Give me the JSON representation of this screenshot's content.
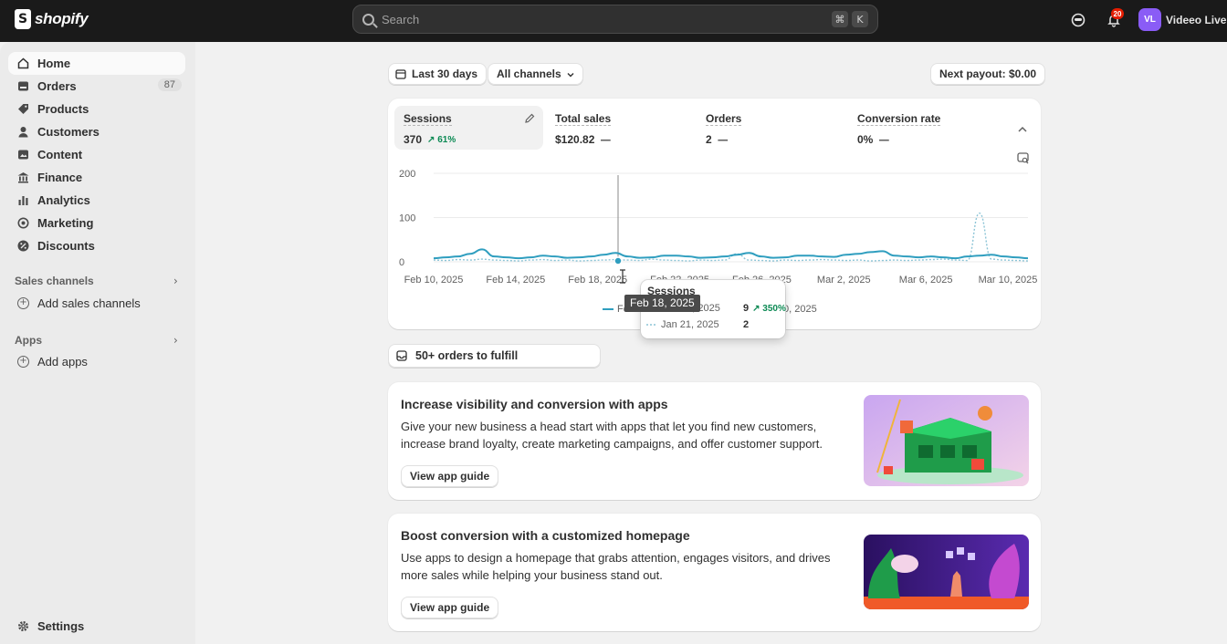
{
  "topbar": {
    "brand": "shopify",
    "search_placeholder": "Search",
    "shortcut_keys": [
      "⌘",
      "K"
    ],
    "notification_count": "20",
    "avatar_initials": "VL",
    "store_name": "Videeo Live"
  },
  "sidebar": {
    "items": [
      {
        "label": "Home",
        "icon": "home-icon",
        "active": true
      },
      {
        "label": "Orders",
        "icon": "orders-icon",
        "count": "87"
      },
      {
        "label": "Products",
        "icon": "tag-icon"
      },
      {
        "label": "Customers",
        "icon": "person-icon"
      },
      {
        "label": "Content",
        "icon": "content-icon"
      },
      {
        "label": "Finance",
        "icon": "bank-icon"
      },
      {
        "label": "Analytics",
        "icon": "bar-chart-icon"
      },
      {
        "label": "Marketing",
        "icon": "target-icon"
      },
      {
        "label": "Discounts",
        "icon": "discount-icon"
      }
    ],
    "sales_channels": {
      "heading": "Sales channels",
      "add_label": "Add sales channels"
    },
    "apps": {
      "heading": "Apps",
      "add_label": "Add apps"
    },
    "settings_label": "Settings"
  },
  "filters": {
    "date_range": "Last 30 days",
    "channels": "All channels",
    "next_payout": "Next payout: $0.00"
  },
  "metrics": [
    {
      "label": "Sessions",
      "value": "370",
      "change": "61%"
    },
    {
      "label": "Total sales",
      "value": "$120.82"
    },
    {
      "label": "Orders",
      "value": "2"
    },
    {
      "label": "Conversion rate",
      "value": "0%"
    }
  ],
  "chart_data": {
    "type": "line",
    "x_ticks": [
      "Feb 10, 2025",
      "Feb 14, 2025",
      "Feb 18, 2025",
      "Feb 22, 2025",
      "Feb 26, 2025",
      "Mar 2, 2025",
      "Mar 6, 2025",
      "Mar 10, 2025"
    ],
    "y_ticks": [
      "200",
      "100",
      "0"
    ],
    "ylim": [
      0,
      200
    ],
    "series": [
      {
        "name": "Feb 10–Mar 11, 2025",
        "style": "solid",
        "color": "#2f9ebf",
        "values": [
          8,
          10,
          12,
          18,
          28,
          12,
          10,
          8,
          10,
          14,
          12,
          9,
          10,
          12,
          16,
          20,
          12,
          9,
          10,
          14,
          14,
          12,
          9,
          10,
          12,
          16,
          20,
          12,
          9,
          10,
          14,
          14,
          12,
          11,
          16,
          18,
          22,
          24,
          14,
          12,
          10,
          12,
          10,
          8,
          12,
          14,
          16,
          12,
          10,
          8
        ]
      },
      {
        "name": "Jan 11–Feb 9, 2025",
        "style": "dotted",
        "color": "#8cc4d6",
        "values": [
          4,
          3,
          5,
          4,
          6,
          4,
          3,
          2,
          4,
          5,
          3,
          4,
          2,
          3,
          4,
          5,
          4,
          3,
          6,
          4,
          3,
          2,
          4,
          3,
          4,
          18,
          4,
          3,
          2,
          4,
          3,
          4,
          5,
          4,
          3,
          4,
          2,
          3,
          4,
          3,
          4,
          5,
          6,
          4,
          3,
          110,
          6,
          4,
          3,
          2
        ]
      }
    ],
    "hover": {
      "date_label": "Feb 18, 2025",
      "title": "Sessions",
      "current": {
        "date": "Feb 18, 2025",
        "value": "9",
        "change": "350%"
      },
      "previous": {
        "date": "Jan 21, 2025",
        "value": "2"
      }
    },
    "legend_partial": [
      "Fe",
      "0, 2025"
    ]
  },
  "fulfill": {
    "label": "50+ orders to fulfill"
  },
  "promos": [
    {
      "title": "Increase visibility and conversion with apps",
      "text": "Give your new business a head start with apps that let you find new customers, increase brand loyalty, create marketing campaigns, and offer customer support.",
      "button": "View app guide"
    },
    {
      "title": "Boost conversion with a customized homepage",
      "text": "Use apps to design a homepage that grabs attention, engages visitors, and drives more sales while helping your business stand out.",
      "button": "View app guide"
    }
  ]
}
